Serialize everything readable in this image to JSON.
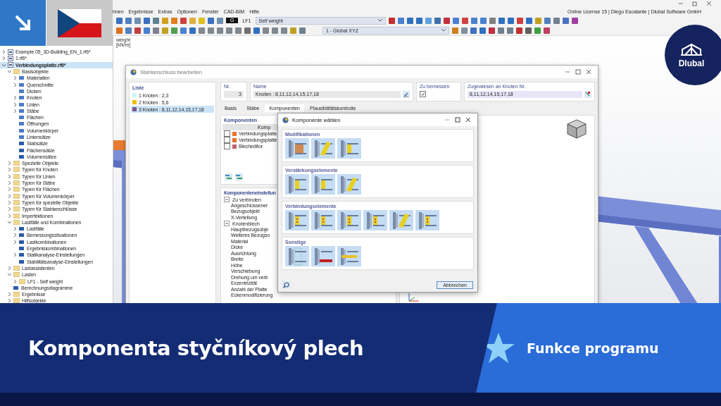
{
  "app": {
    "menu": [
      "hnen",
      "Ergebnisse",
      "Extras",
      "Optionen",
      "Fenster",
      "CAD-BIM",
      "Hilfe"
    ],
    "license": "Online License 15 | Diego Escalante | Dlubal Software GmbH",
    "load_case": {
      "tag": "G",
      "id": "LF1",
      "name": "Self weight"
    },
    "coordinate_system": "1 - Global XYZ"
  },
  "navigator": {
    "items": [
      {
        "label": "Example 05_3D-Building_EN_1.rf6*",
        "kind": "file",
        "expanded": false,
        "selected": false
      },
      {
        "label": "1.rf6*",
        "kind": "file",
        "expanded": false,
        "selected": false
      },
      {
        "label": "Verbindungsplatte.rf6*",
        "kind": "file",
        "expanded": true,
        "selected": true,
        "children": [
          {
            "label": "Basisobjekte",
            "kind": "folder",
            "expanded": true,
            "selected": false,
            "children": [
              {
                "label": "Materialien",
                "kind": "object",
                "expanded": false,
                "selected": false
              },
              {
                "label": "Querschnitte",
                "kind": "object",
                "expanded": false,
                "selected": false
              },
              {
                "label": "Dicken",
                "kind": "object",
                "selected": false
              },
              {
                "label": "Knoten",
                "kind": "object",
                "expanded": false,
                "selected": false
              },
              {
                "label": "Linien",
                "kind": "object",
                "expanded": false,
                "selected": false
              },
              {
                "label": "Stäbe",
                "kind": "object",
                "expanded": false,
                "selected": false
              },
              {
                "label": "Flächen",
                "kind": "object",
                "selected": false
              },
              {
                "label": "Öffnungen",
                "kind": "object",
                "selected": false
              },
              {
                "label": "Volumenkörper",
                "kind": "object",
                "selected": false
              },
              {
                "label": "Liniensätze",
                "kind": "object",
                "selected": false
              },
              {
                "label": "Stabsätze",
                "kind": "object",
                "selected": false
              },
              {
                "label": "Flächensätze",
                "kind": "object",
                "selected": false
              },
              {
                "label": "Volumensätze",
                "kind": "object",
                "selected": false
              }
            ]
          },
          {
            "label": "Spezielle Objekte",
            "kind": "folder",
            "expanded": false,
            "selected": false
          },
          {
            "label": "Typen für Knoten",
            "kind": "folder",
            "expanded": false,
            "selected": false
          },
          {
            "label": "Typen für Linien",
            "kind": "folder",
            "expanded": false,
            "selected": false
          },
          {
            "label": "Typen für Stäbe",
            "kind": "folder",
            "expanded": false,
            "selected": false
          },
          {
            "label": "Typen für Flächen",
            "kind": "folder",
            "expanded": false,
            "selected": false
          },
          {
            "label": "Typen für Volumenkörper",
            "kind": "folder",
            "expanded": false,
            "selected": false
          },
          {
            "label": "Typen für spezielle Objekte",
            "kind": "folder",
            "expanded": false,
            "selected": false
          },
          {
            "label": "Typen für Stahlanschlüsse",
            "kind": "folder",
            "expanded": false,
            "selected": false
          },
          {
            "label": "Imperfektionen",
            "kind": "folder",
            "expanded": false,
            "selected": false
          },
          {
            "label": "Lastfälle und Kombinationen",
            "kind": "folder",
            "expanded": true,
            "selected": false,
            "children": [
              {
                "label": "Lastfälle",
                "kind": "object",
                "expanded": false,
                "selected": false
              },
              {
                "label": "Bemessungssituationen",
                "kind": "object",
                "expanded": false,
                "selected": false
              },
              {
                "label": "Lastkombinationen",
                "kind": "object",
                "expanded": false,
                "selected": false
              },
              {
                "label": "Ergebniskombinationen",
                "kind": "object",
                "selected": false
              },
              {
                "label": "Statikanalyse-Einstellungen",
                "kind": "object",
                "expanded": false,
                "selected": false
              },
              {
                "label": "Stabilitätsanalyse-Einstellungen",
                "kind": "object",
                "selected": false
              }
            ]
          },
          {
            "label": "Lastassistenten",
            "kind": "folder",
            "expanded": false,
            "selected": false
          },
          {
            "label": "Lasten",
            "kind": "folder",
            "expanded": true,
            "selected": false,
            "children": [
              {
                "label": "LF1 - Self weight",
                "kind": "folder",
                "expanded": false,
                "selected": false
              }
            ]
          },
          {
            "label": "Berechnungsdiagramme",
            "kind": "object",
            "selected": false
          },
          {
            "label": "Ergebnisse",
            "kind": "folder",
            "expanded": false,
            "selected": false
          },
          {
            "label": "Hilfsobjekte",
            "kind": "folder",
            "expanded": false,
            "selected": false
          }
        ]
      }
    ]
  },
  "viewport": {
    "labels": [
      "weight",
      "[kN/m]"
    ]
  },
  "connection_dialog": {
    "title": "Stahlanschluss bearbeiten",
    "list_title": "Liste",
    "list": [
      {
        "label": "1  Knoten : 2,3",
        "color": "#c8f4f4",
        "selected": false
      },
      {
        "label": "2  Knoten : 5,6",
        "color": "#f0c000",
        "selected": false
      },
      {
        "label": "3  Knoten : 8,11,12,14,15,17,18",
        "color": "#7a5a8a",
        "selected": true
      }
    ],
    "number_label": "Nr.",
    "number": "3",
    "name_label": "Name",
    "name": "Knoten : 8,11,12,14,15,17,18",
    "design_label": "Zu bemessen",
    "design": true,
    "assigned_label": "Zugewiesen an Knoten Nr.",
    "assigned": "8,11,12,14,15,17,18",
    "tabs": [
      {
        "label": "Basis",
        "selected": false
      },
      {
        "label": "Stäbe",
        "selected": false
      },
      {
        "label": "Komponenten",
        "selected": true
      },
      {
        "label": "Plausibilitätskontrolle",
        "selected": false
      }
    ],
    "components_title": "Komponenten",
    "components_column": "Komp",
    "components": [
      {
        "label": "Verbindungsplatte",
        "color": "#e8702c",
        "checked": false
      },
      {
        "label": "Verbindungsplatte",
        "color": "#e8702c",
        "checked": false
      },
      {
        "label": "Blecheditor",
        "color": "#c0606c",
        "checked": false
      }
    ],
    "settings_title": "Komponenteneinstellun",
    "settings": [
      {
        "label": "Zu verbinden",
        "expanded": true,
        "children": [
          "Angeschlossener",
          "Bezugsobjekt",
          "X-Verteilung"
        ]
      },
      {
        "label": "Knotenblech",
        "expanded": true,
        "children": [
          "Hauptbezugsobje",
          "Weiteres Bezugso",
          "Material",
          "Dicke",
          "Ausrichtung",
          "Breite",
          "Höhe",
          "Verschiebung",
          "Drehung um verb",
          "Exzentrizität",
          "Anzahl der Platte",
          "Eckenmodifizierung"
        ]
      }
    ]
  },
  "component_dialog": {
    "title": "Komponente wählen",
    "sections": [
      {
        "title": "Modifikationen",
        "tiles": [
          {
            "kind": "cut"
          },
          {
            "kind": "chamfer"
          },
          {
            "kind": "plate"
          }
        ]
      },
      {
        "title": "Verstärkungselemente",
        "tiles": [
          {
            "kind": "stiffener"
          },
          {
            "kind": "stiffener"
          },
          {
            "kind": "haunch"
          }
        ]
      },
      {
        "title": "Verbindungselemente",
        "tiles": [
          {
            "kind": "bolted"
          },
          {
            "kind": "bolted"
          },
          {
            "kind": "bolted"
          },
          {
            "kind": "bolted"
          },
          {
            "kind": "gusset"
          },
          {
            "kind": "bolted"
          }
        ]
      },
      {
        "title": "Sonstige",
        "tiles": [
          {
            "kind": "grid"
          },
          {
            "kind": "weld"
          },
          {
            "kind": "flat"
          }
        ]
      }
    ],
    "cancel": "Abbrechen"
  },
  "brand": {
    "name": "Dlubal"
  },
  "banner": {
    "title": "Komponenta styčníkový plech",
    "tag": "Funkce programu"
  }
}
